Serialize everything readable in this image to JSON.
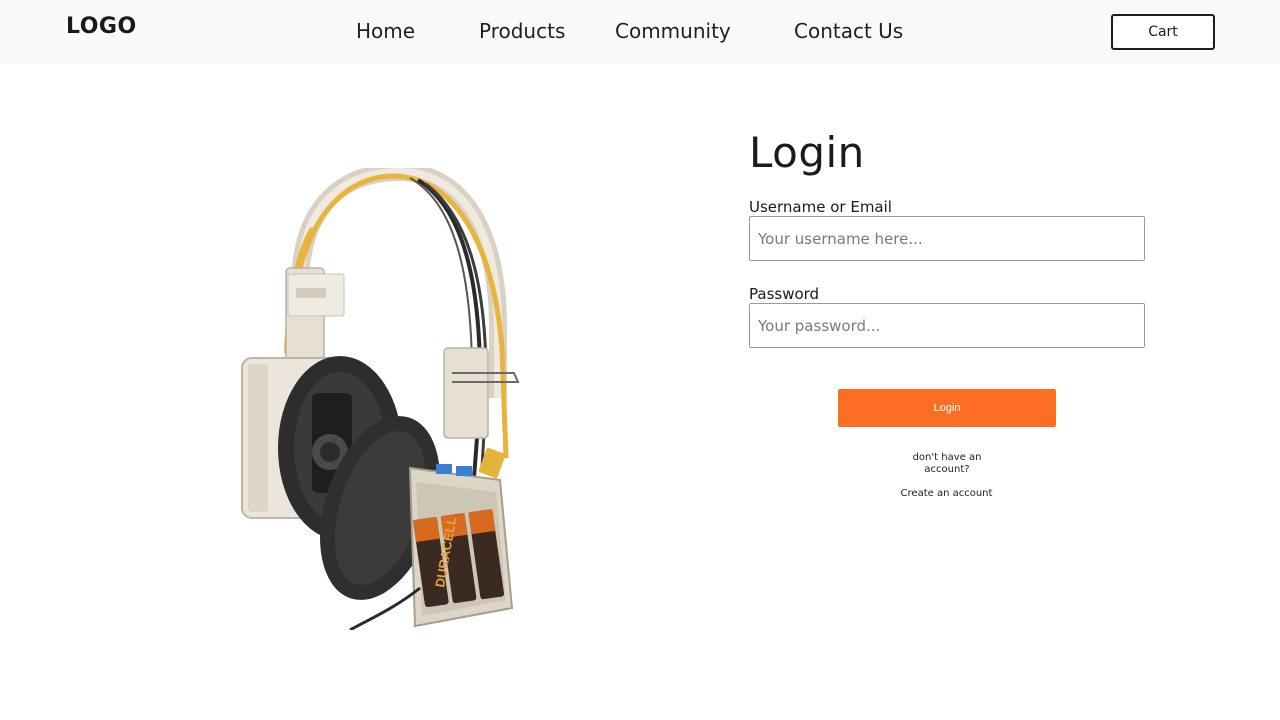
{
  "header": {
    "logo": "LOGO",
    "nav": [
      {
        "label": "Home"
      },
      {
        "label": "Products"
      },
      {
        "label": "Community"
      },
      {
        "label": "Contact Us"
      }
    ],
    "cart_label": "Cart"
  },
  "product_image": {
    "battery_brand": "DURACELL"
  },
  "login": {
    "title": "Login",
    "username_label": "Username or Email",
    "username_placeholder": "Your username here...",
    "password_label": "Password",
    "password_placeholder": "Your password...",
    "submit_label": "Login",
    "no_account_text": "don't have an account?",
    "create_account_label": "Create an account"
  },
  "colors": {
    "accent": "#fd6d24",
    "header_bg": "#fafafa"
  }
}
